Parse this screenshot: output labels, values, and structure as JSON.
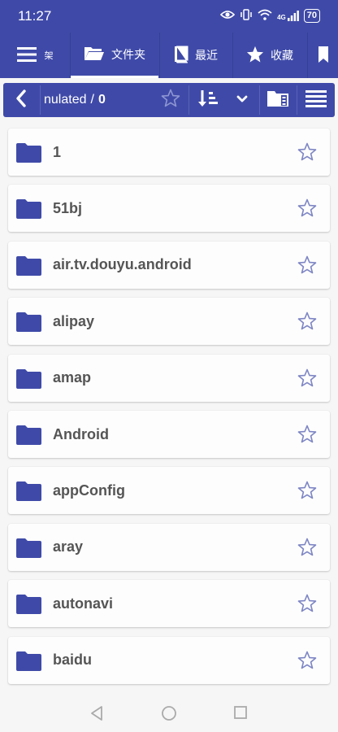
{
  "status": {
    "time": "11:27",
    "signal": "4G",
    "battery": "70"
  },
  "tabs": [
    {
      "label": "架",
      "icon": "sidebar-pane-icon"
    },
    {
      "label": "文件夹",
      "icon": "folder-open-icon"
    },
    {
      "label": "最近",
      "icon": "book-icon"
    },
    {
      "label": "收藏",
      "icon": "star-icon"
    },
    {
      "label": "",
      "icon": "bookmark-icon"
    }
  ],
  "path": {
    "text": "nulated",
    "separator": "/",
    "level": "0"
  },
  "folders": [
    {
      "name": "1"
    },
    {
      "name": "51bj"
    },
    {
      "name": "air.tv.douyu.android"
    },
    {
      "name": "alipay"
    },
    {
      "name": "amap"
    },
    {
      "name": "Android"
    },
    {
      "name": "appConfig"
    },
    {
      "name": "aray"
    },
    {
      "name": "autonavi"
    },
    {
      "name": "baidu"
    }
  ],
  "colors": {
    "primary": "#3f4aa8",
    "folder": "#3f4aa8",
    "star": "#7e86c4"
  }
}
